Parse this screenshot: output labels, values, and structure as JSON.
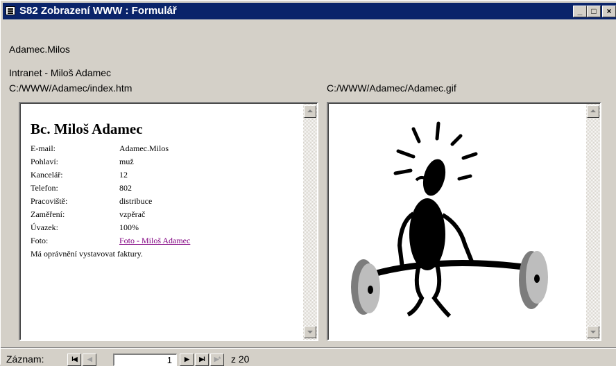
{
  "window": {
    "title": "S82 Zobrazení WWW : Formulář",
    "min_glyph": "_",
    "max_glyph": "□",
    "close_glyph": "×"
  },
  "form": {
    "login": "Adamec.Milos",
    "page_title": "Intranet - Miloš Adamec",
    "html_path": "C:/WWW/Adamec/index.htm",
    "image_path": "C:/WWW/Adamec/Adamec.gif"
  },
  "document": {
    "heading": "Bc. Miloš Adamec",
    "rows": [
      {
        "key": "E-mail:",
        "value": "Adamec.Milos"
      },
      {
        "key": "Pohlaví:",
        "value": "muž"
      },
      {
        "key": "Kancelář:",
        "value": "12"
      },
      {
        "key": "Telefon:",
        "value": "802"
      },
      {
        "key": "Pracoviště:",
        "value": "distribuce"
      },
      {
        "key": "Zaměření:",
        "value": "vzpěrač"
      },
      {
        "key": "Úvazek:",
        "value": "100%"
      },
      {
        "key": "Foto:",
        "value": "Foto - Miloš Adamec",
        "link": true
      }
    ],
    "note": "Má oprávnění vystavovat faktury."
  },
  "navigation": {
    "label": "Záznam:",
    "current_record": "1",
    "total_label": "z 20",
    "first_glyph": "I◀",
    "prev_glyph": "◀",
    "next_glyph": "▶",
    "last_glyph": "▶I",
    "new_glyph": "▶*"
  },
  "colors": {
    "titlebar": "#0a246a",
    "face": "#d4d0c8",
    "link_visited": "#800080"
  },
  "icons": [
    "form-icon",
    "minimize-icon",
    "maximize-icon",
    "close-icon",
    "scroll-up-icon",
    "scroll-down-icon",
    "weightlifter-image"
  ]
}
